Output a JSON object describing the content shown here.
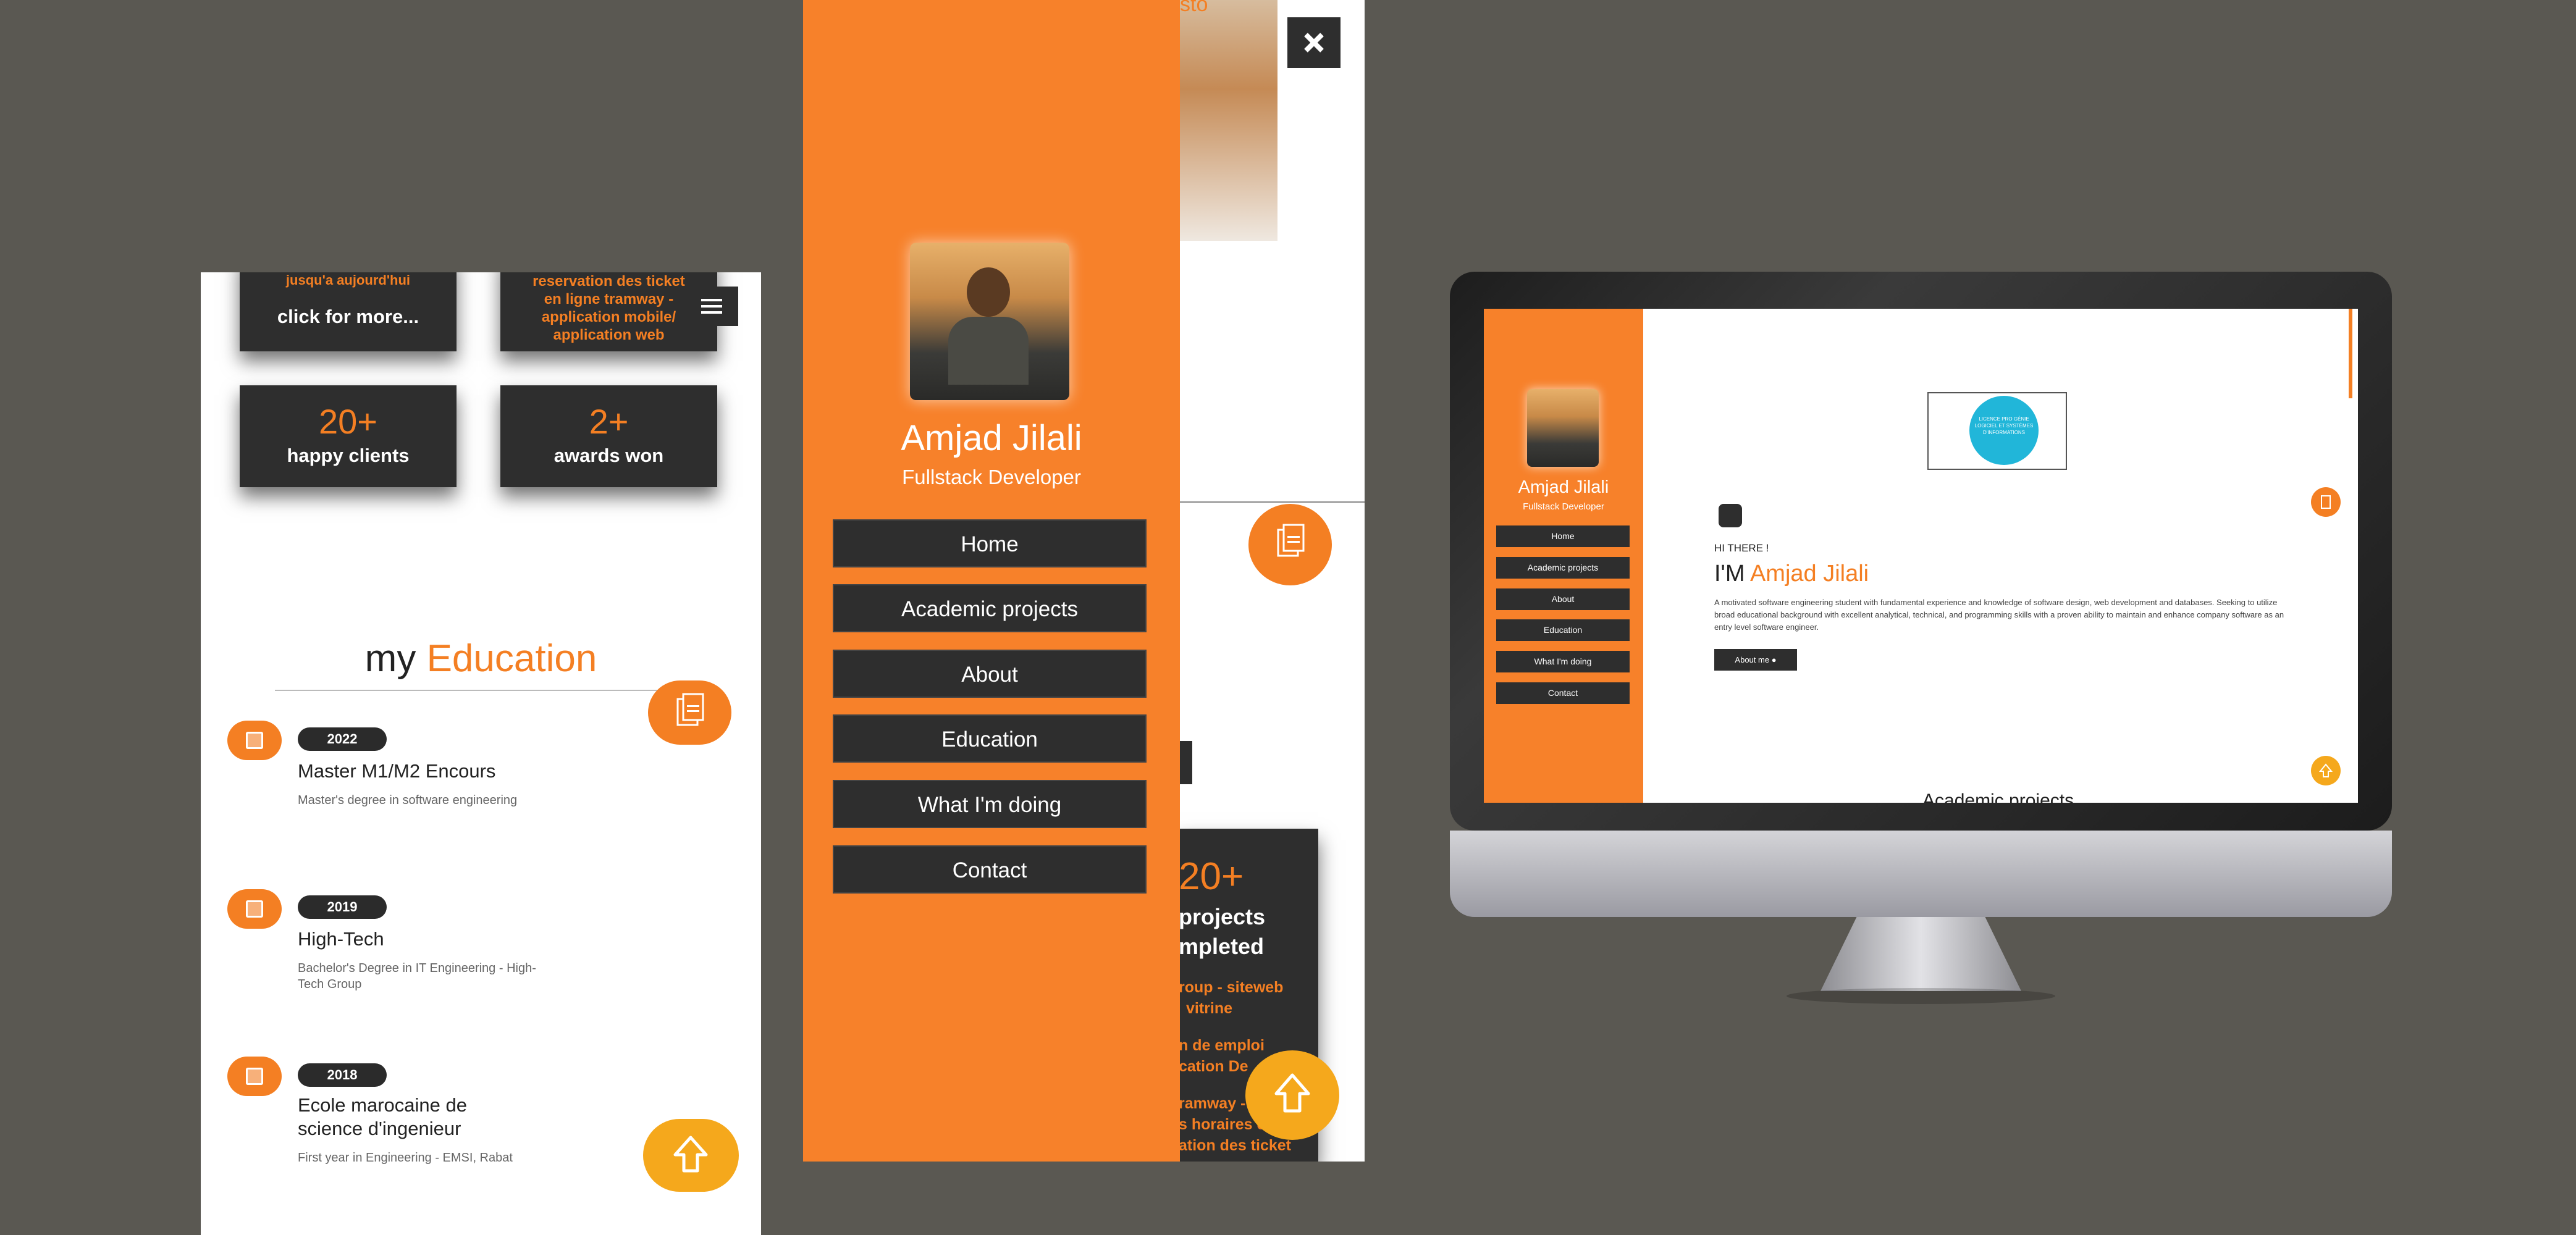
{
  "colors": {
    "accent": "#f47f23",
    "dark": "#2e2e2e",
    "backdrop": "#5a5852"
  },
  "left_phone": {
    "card_top_left_text": "click for more...",
    "card_top_left_cut": "jusqu'a aujourd'hui",
    "card_top_right_text": "reservation des ticket en ligne tramway - application mobile/ application web",
    "menu_icon": "hamburger-icon",
    "stats": [
      {
        "num": "20+",
        "label": "happy clients"
      },
      {
        "num": "2+",
        "label": "awards won"
      }
    ],
    "section_title_prefix": "my",
    "section_title_accent": "Education",
    "education": [
      {
        "year": "2022",
        "degree": "Master M1/M2 Encours",
        "desc": "Master's degree in software engineering"
      },
      {
        "year": "2019",
        "degree": "High-Tech",
        "desc": "Bachelor's Degree in IT Engineering - High-Tech Group"
      },
      {
        "year": "2018",
        "degree": "Ecole marocaine de science d'ingenieur",
        "desc": "First year in Engineering - EMSI, Rabat"
      }
    ]
  },
  "middle_phone": {
    "name": "Amjad Jilali",
    "role": "Fullstack Developer",
    "menu": [
      "Home",
      "Academic projects",
      "About",
      "Education",
      "What I'm doing",
      "Contact"
    ],
    "close_icon": "close-icon",
    "top_peek": "sto",
    "stat_num": "20+",
    "stat_label_1": "projects",
    "stat_label_2": "mpleted",
    "peek_lines": [
      "roup - siteweb",
      "vitrine",
      "n de emploi",
      "cation De",
      "ramway - g",
      "s horaires et",
      "ation des ticket"
    ]
  },
  "monitor": {
    "name": "Amjad Jilali",
    "role": "Fullstack Developer",
    "menu": [
      "Home",
      "Academic projects",
      "About",
      "Education",
      "What I'm doing",
      "Contact"
    ],
    "hero_image_text": "LICENCE PRO GÉNIE LOGICIEL ET SYSTÈMES D'INFORMATIONS",
    "greeting": "HI THERE !",
    "im_prefix": "I'M",
    "im_name": "Amjad Jilali",
    "bio": "A motivated software engineering student with fundamental experience and knowledge of software design, web development and databases. Seeking to utilize broad educational background with excellent analytical, technical, and programming skills with a proven ability to maintain and enhance company software as an entry level software engineer.",
    "about_button": "About me",
    "peek_section": "Academic projects"
  }
}
